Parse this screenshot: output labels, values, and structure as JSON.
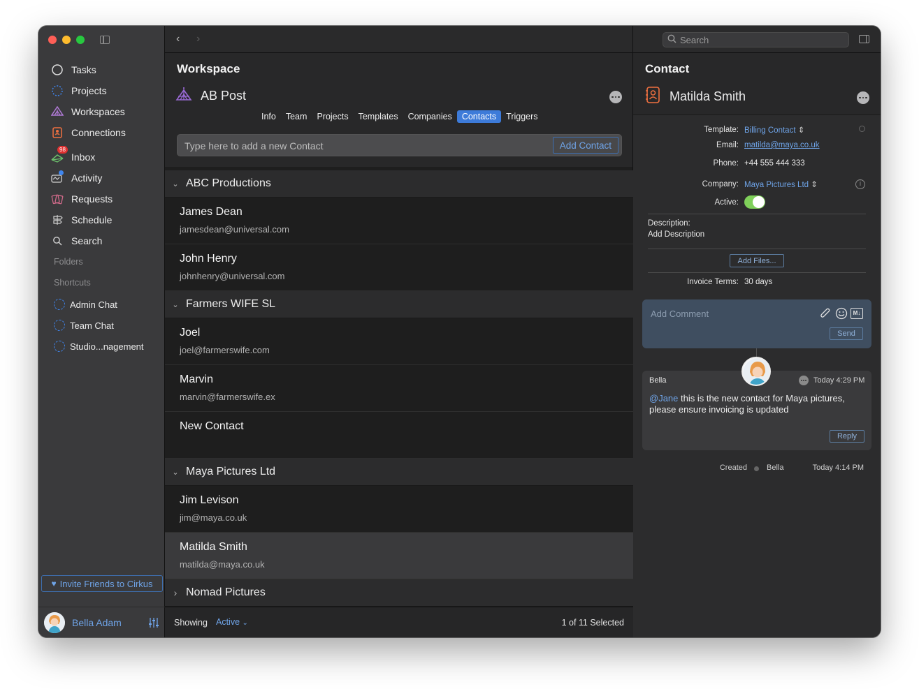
{
  "sidebar": {
    "nav": [
      {
        "label": "Tasks",
        "icon": "circle-icon"
      },
      {
        "label": "Projects",
        "icon": "dashed-circle-icon"
      },
      {
        "label": "Workspaces",
        "icon": "tent-icon"
      },
      {
        "label": "Connections",
        "icon": "contact-card-icon"
      },
      {
        "label": "Inbox",
        "icon": "inbox-icon",
        "badge": "98"
      },
      {
        "label": "Activity",
        "icon": "activity-icon"
      },
      {
        "label": "Requests",
        "icon": "requests-icon"
      },
      {
        "label": "Schedule",
        "icon": "schedule-icon"
      },
      {
        "label": "Search",
        "icon": "search-icon"
      }
    ],
    "folders_label": "Folders",
    "shortcuts_label": "Shortcuts",
    "shortcuts": [
      "Admin Chat",
      "Team Chat",
      "Studio...nagement"
    ],
    "invite_label": "Invite Friends to Cirkus",
    "user_name": "Bella Adam"
  },
  "middle": {
    "workspace_title": "Workspace",
    "workspace_name": "AB Post",
    "tabs": [
      "Info",
      "Team",
      "Projects",
      "Templates",
      "Companies",
      "Contacts",
      "Triggers"
    ],
    "active_tab": "Contacts",
    "add_placeholder": "Type here to add a new Contact",
    "add_button": "Add Contact",
    "groups": [
      {
        "name": "ABC Productions",
        "expanded": true,
        "contacts": [
          {
            "name": "James Dean",
            "email": "jamesdean@universal.com"
          },
          {
            "name": "John Henry",
            "email": "johnhenry@universal.com"
          }
        ]
      },
      {
        "name": "Farmers WIFE SL",
        "expanded": true,
        "contacts": [
          {
            "name": "Joel",
            "email": "joel@farmerswife.com"
          },
          {
            "name": "Marvin",
            "email": "marvin@farmerswife.ex"
          },
          {
            "name": "New Contact",
            "email": ""
          }
        ]
      },
      {
        "name": "Maya Pictures Ltd",
        "expanded": true,
        "contacts": [
          {
            "name": "Jim Levison",
            "email": "jim@maya.co.uk"
          },
          {
            "name": "Matilda Smith",
            "email": "matilda@maya.co.uk",
            "selected": true
          }
        ]
      },
      {
        "name": "Nomad Pictures",
        "expanded": false,
        "contacts": []
      }
    ],
    "footer": {
      "showing_label": "Showing",
      "filter": "Active",
      "count": "1 of 11 Selected"
    }
  },
  "right": {
    "search_placeholder": "Search",
    "title": "Contact",
    "contact_name": "Matilda Smith",
    "fields": {
      "template_label": "Template:",
      "template_value": "Billing Contact",
      "email_label": "Email:",
      "email_value": "matilda@maya.co.uk",
      "phone_label": "Phone:",
      "phone_value": "+44 555 444 333",
      "company_label": "Company:",
      "company_value": "Maya Pictures Ltd",
      "active_label": "Active:"
    },
    "description_label": "Description:",
    "description_value": "Add Description",
    "add_files": "Add Files...",
    "invoice_label": "Invoice Terms:",
    "invoice_value": "30 days",
    "comment_placeholder": "Add Comment",
    "send_label": "Send",
    "comment": {
      "author": "Bella",
      "time": "Today 4:29 PM",
      "mention": "@Jane",
      "text": " this is the new contact for Maya pictures, please ensure invoicing is updated",
      "reply_label": "Reply"
    },
    "created": {
      "label": "Created",
      "by": "Bella",
      "time": "Today 4:14 PM"
    }
  },
  "colors": {
    "accent": "#3d7bd9",
    "link": "#6fa4e8",
    "toggle": "#7fd05a"
  }
}
